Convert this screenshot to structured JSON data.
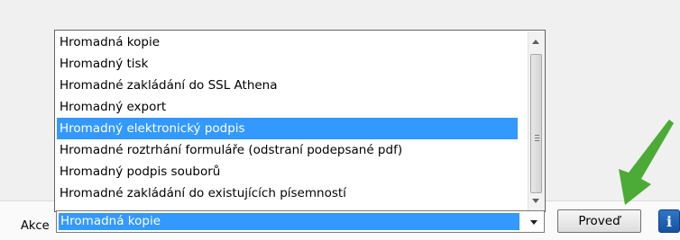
{
  "dropdown": {
    "options": [
      "Hromadná kopie",
      "Hromadný tisk",
      "Hromadné zakládání do SSL Athena",
      "Hromadný export",
      "Hromadný elektronický podpis",
      "Hromadné roztrhání formuláře (odstraní podepsané pdf)",
      "Hromadný podpis souborů",
      "Hromadné zakládání do existujících písemností"
    ],
    "highlighted_index": 4
  },
  "action": {
    "label": "Akce",
    "selected_value": "Hromadná kopie"
  },
  "buttons": {
    "run_label": "Proveď",
    "info_label": "i"
  },
  "colors": {
    "selection": "#3399ff",
    "arrow": "#4caa36",
    "info": "#1d5faf"
  },
  "icons": {
    "annotation": "green-arrow-icon",
    "info": "info-icon"
  }
}
